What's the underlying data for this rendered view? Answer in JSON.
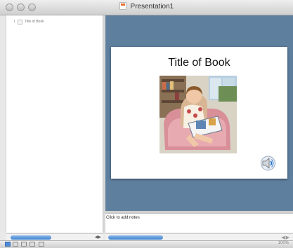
{
  "window": {
    "title": "Presentation1"
  },
  "sidebar": {
    "items": [
      {
        "number": "1",
        "label": "Title of Book"
      }
    ]
  },
  "slide": {
    "title": "Title of Book",
    "photo": "photo of a child reading a book in a pink armchair",
    "speaker_icon": "speaker-icon"
  },
  "notes": {
    "placeholder": "Click to add notes"
  },
  "colors": {
    "slide_background": "#5f7f9f",
    "scroll_thumb": "#3f83d1",
    "selected_view": "#4e8bd6"
  },
  "statusbar": {
    "zoom": "100%"
  }
}
